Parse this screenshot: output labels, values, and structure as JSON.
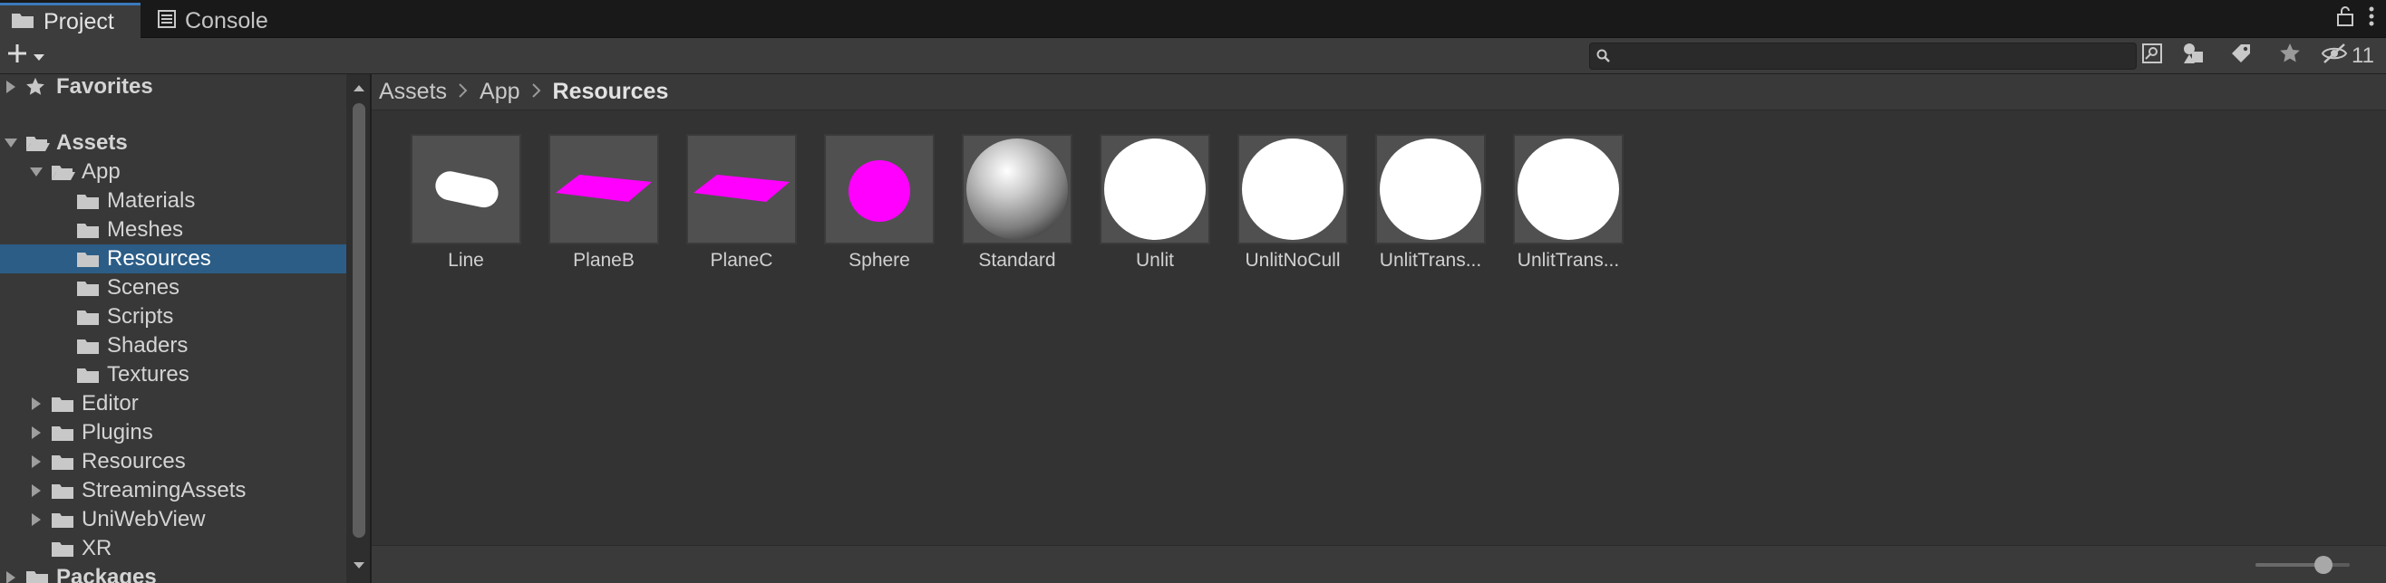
{
  "tabs": [
    {
      "label": "Project",
      "icon": "folder-icon",
      "active": true
    },
    {
      "label": "Console",
      "icon": "console-icon",
      "active": false
    }
  ],
  "toolbar": {
    "create_icon": "plus-icon",
    "search": {
      "value": "",
      "placeholder": ""
    },
    "hidden_count": "11"
  },
  "tree": {
    "items": [
      {
        "label": "Favorites",
        "indent": 0,
        "expanded": false,
        "bold": true,
        "icon": "star-icon",
        "selected": false
      },
      {
        "label": "Assets",
        "indent": 0,
        "expanded": true,
        "bold": true,
        "icon": "folder-open-icon",
        "selected": false
      },
      {
        "label": "App",
        "indent": 1,
        "expanded": true,
        "bold": false,
        "icon": "folder-open-icon",
        "selected": false
      },
      {
        "label": "Materials",
        "indent": 2,
        "expanded": null,
        "bold": false,
        "icon": "folder-icon",
        "selected": false
      },
      {
        "label": "Meshes",
        "indent": 2,
        "expanded": null,
        "bold": false,
        "icon": "folder-icon",
        "selected": false
      },
      {
        "label": "Resources",
        "indent": 2,
        "expanded": null,
        "bold": false,
        "icon": "folder-icon",
        "selected": true
      },
      {
        "label": "Scenes",
        "indent": 2,
        "expanded": null,
        "bold": false,
        "icon": "folder-icon",
        "selected": false
      },
      {
        "label": "Scripts",
        "indent": 2,
        "expanded": null,
        "bold": false,
        "icon": "folder-icon",
        "selected": false
      },
      {
        "label": "Shaders",
        "indent": 2,
        "expanded": null,
        "bold": false,
        "icon": "folder-icon",
        "selected": false
      },
      {
        "label": "Textures",
        "indent": 2,
        "expanded": null,
        "bold": false,
        "icon": "folder-icon",
        "selected": false
      },
      {
        "label": "Editor",
        "indent": 1,
        "expanded": false,
        "bold": false,
        "icon": "folder-icon",
        "selected": false
      },
      {
        "label": "Plugins",
        "indent": 1,
        "expanded": false,
        "bold": false,
        "icon": "folder-icon",
        "selected": false
      },
      {
        "label": "Resources",
        "indent": 1,
        "expanded": false,
        "bold": false,
        "icon": "folder-icon",
        "selected": false
      },
      {
        "label": "StreamingAssets",
        "indent": 1,
        "expanded": false,
        "bold": false,
        "icon": "folder-icon",
        "selected": false
      },
      {
        "label": "UniWebView",
        "indent": 1,
        "expanded": false,
        "bold": false,
        "icon": "folder-icon",
        "selected": false
      },
      {
        "label": "XR",
        "indent": 1,
        "expanded": null,
        "bold": false,
        "icon": "folder-icon",
        "selected": false
      },
      {
        "label": "Packages",
        "indent": 0,
        "expanded": false,
        "bold": true,
        "icon": "folder-icon",
        "selected": false
      }
    ]
  },
  "breadcrumb": {
    "items": [
      "Assets",
      "App"
    ],
    "current": "Resources"
  },
  "assets": [
    {
      "label": "Line",
      "preview": "capsule"
    },
    {
      "label": "PlaneB",
      "preview": "magenta-plane"
    },
    {
      "label": "PlaneC",
      "preview": "magenta-plane"
    },
    {
      "label": "Sphere",
      "preview": "magenta-sphere"
    },
    {
      "label": "Standard",
      "preview": "standard-sphere"
    },
    {
      "label": "Unlit",
      "preview": "white-sphere"
    },
    {
      "label": "UnlitNoCull",
      "preview": "white-sphere"
    },
    {
      "label": "UnlitTrans...",
      "preview": "white-sphere"
    },
    {
      "label": "UnlitTrans...",
      "preview": "white-sphere"
    }
  ],
  "zoom": {
    "level": 0.72
  },
  "colors": {
    "accent": "#3a79bb",
    "selection": "#2c5d87",
    "magenta": "#ff00ff"
  }
}
